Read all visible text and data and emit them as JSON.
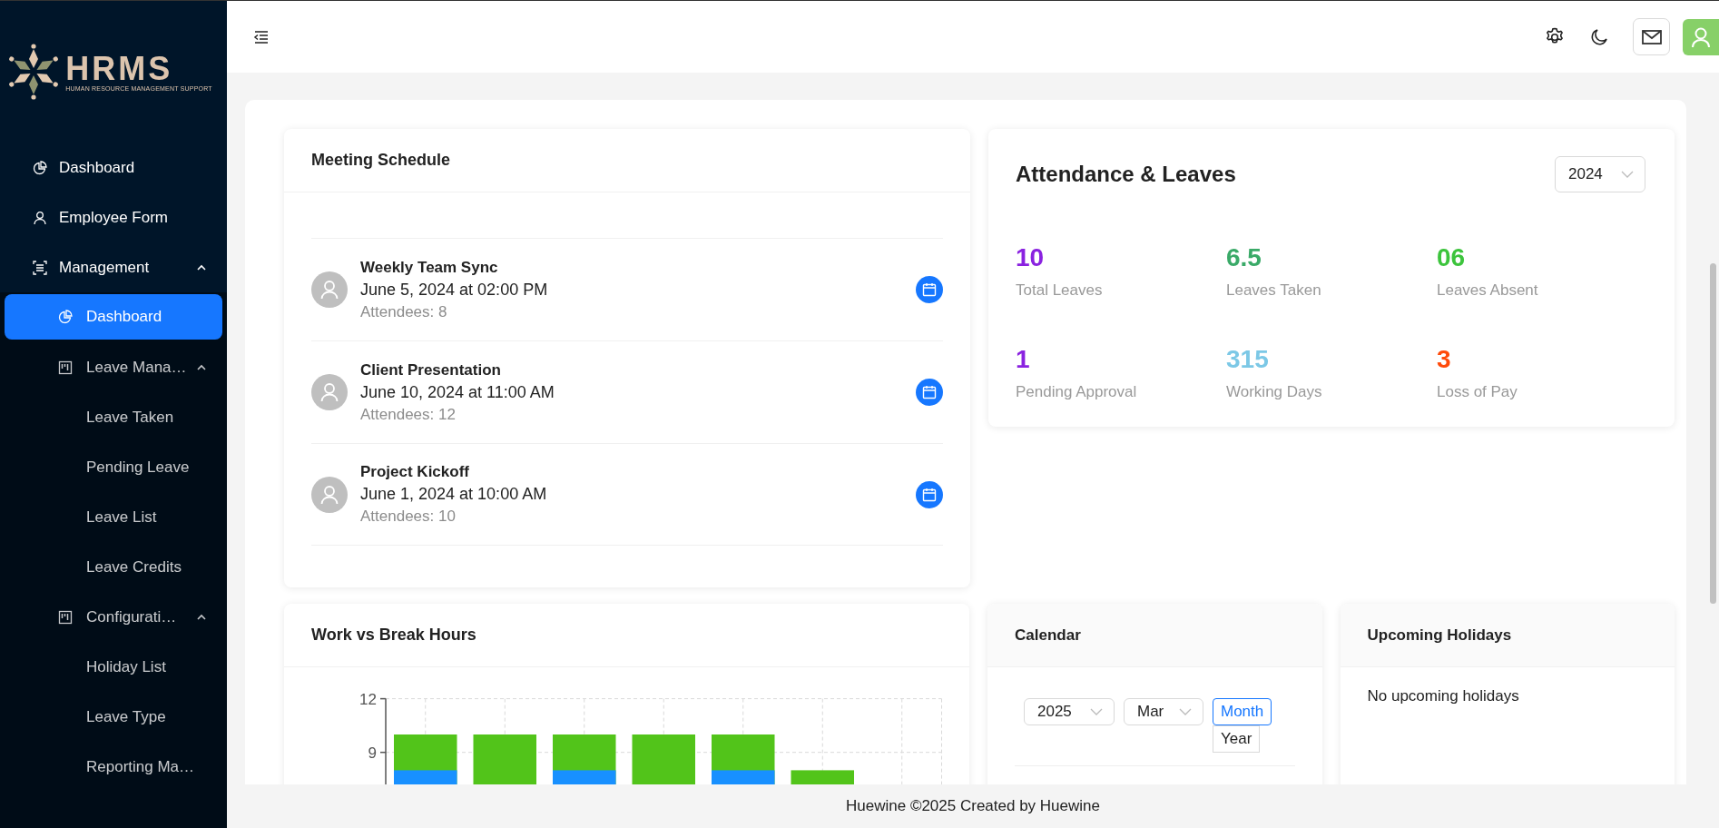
{
  "sidebar": {
    "logo": {
      "text": "HRMS",
      "tagline": "HUMAN RESOURCE MANAGEMENT SUPPORT"
    },
    "items": [
      {
        "kind": "link",
        "label": "Dashboard",
        "selected": false
      },
      {
        "kind": "link",
        "label": "Employee Form",
        "selected": false
      },
      {
        "kind": "group",
        "label": "Management",
        "expanded": true,
        "children": [
          {
            "kind": "link",
            "label": "Dashboard",
            "selected": true
          },
          {
            "kind": "group",
            "label": "Leave Mana…",
            "expanded": true,
            "children": [
              {
                "kind": "link",
                "label": "Leave Taken",
                "selected": false
              },
              {
                "kind": "link",
                "label": "Pending Leave",
                "selected": false
              },
              {
                "kind": "link",
                "label": "Leave List",
                "selected": false
              },
              {
                "kind": "link",
                "label": "Leave Credits",
                "selected": false
              }
            ]
          },
          {
            "kind": "group",
            "label": "Configurati…",
            "expanded": true,
            "children": [
              {
                "kind": "link",
                "label": "Holiday List",
                "selected": false
              },
              {
                "kind": "link",
                "label": "Leave Type",
                "selected": false
              },
              {
                "kind": "link",
                "label": "Reporting Ma…",
                "selected": false
              }
            ]
          }
        ]
      }
    ]
  },
  "meetings": {
    "title": "Meeting Schedule",
    "items": [
      {
        "title": "Weekly Team Sync",
        "when": "June 5, 2024 at 02:00 PM",
        "attendees": "Attendees: 8"
      },
      {
        "title": "Client Presentation",
        "when": "June 10, 2024 at 11:00 AM",
        "attendees": "Attendees: 12"
      },
      {
        "title": "Project Kickoff",
        "when": "June 1, 2024 at 10:00 AM",
        "attendees": "Attendees: 10"
      }
    ]
  },
  "attendance": {
    "title": "Attendance & Leaves",
    "year": "2024",
    "stats": [
      {
        "value": "10",
        "label": "Total Leaves",
        "color": "#8a22e0"
      },
      {
        "value": "6.5",
        "label": "Leaves Taken",
        "color": "#3aaa68"
      },
      {
        "value": "06",
        "label": "Leaves Absent",
        "color": "#3cc43c"
      },
      {
        "value": "1",
        "label": "Pending Approval",
        "color": "#8a22e0"
      },
      {
        "value": "315",
        "label": "Working Days",
        "color": "#7cc8e6"
      },
      {
        "value": "3",
        "label": "Loss of Pay",
        "color": "#ff4a0a"
      }
    ]
  },
  "work_hours": {
    "title": "Work vs Break Hours",
    "chart_data": {
      "type": "bar",
      "grid": true,
      "ylim": [
        0,
        12
      ],
      "yticks": [
        9,
        12
      ],
      "series": [
        {
          "color": "#52c41a",
          "values": [
            10,
            10,
            10,
            10,
            10,
            8,
            null
          ]
        },
        {
          "color": "#1890ff",
          "values": [
            8,
            null,
            8,
            null,
            8,
            null,
            null
          ]
        }
      ]
    }
  },
  "calendar": {
    "title": "Calendar",
    "year": "2025",
    "month": "Mar",
    "modes": [
      {
        "label": "Month",
        "selected": true
      },
      {
        "label": "Year",
        "selected": false
      }
    ]
  },
  "holidays": {
    "title": "Upcoming Holidays",
    "empty": "No upcoming holidays"
  },
  "footer": "Huewine ©2025 Created by Huewine"
}
